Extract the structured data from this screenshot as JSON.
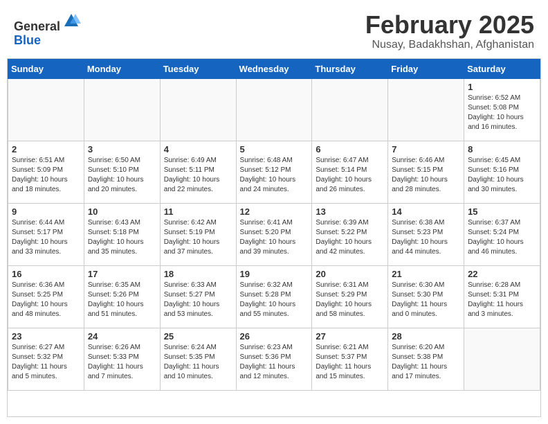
{
  "logo": {
    "general": "General",
    "blue": "Blue"
  },
  "header": {
    "month": "February 2025",
    "location": "Nusay, Badakhshan, Afghanistan"
  },
  "weekdays": [
    "Sunday",
    "Monday",
    "Tuesday",
    "Wednesday",
    "Thursday",
    "Friday",
    "Saturday"
  ],
  "weeks": [
    [
      {
        "day": "",
        "info": ""
      },
      {
        "day": "",
        "info": ""
      },
      {
        "day": "",
        "info": ""
      },
      {
        "day": "",
        "info": ""
      },
      {
        "day": "",
        "info": ""
      },
      {
        "day": "",
        "info": ""
      },
      {
        "day": "1",
        "info": "Sunrise: 6:52 AM\nSunset: 5:08 PM\nDaylight: 10 hours\nand 16 minutes."
      }
    ],
    [
      {
        "day": "2",
        "info": "Sunrise: 6:51 AM\nSunset: 5:09 PM\nDaylight: 10 hours\nand 18 minutes."
      },
      {
        "day": "3",
        "info": "Sunrise: 6:50 AM\nSunset: 5:10 PM\nDaylight: 10 hours\nand 20 minutes."
      },
      {
        "day": "4",
        "info": "Sunrise: 6:49 AM\nSunset: 5:11 PM\nDaylight: 10 hours\nand 22 minutes."
      },
      {
        "day": "5",
        "info": "Sunrise: 6:48 AM\nSunset: 5:12 PM\nDaylight: 10 hours\nand 24 minutes."
      },
      {
        "day": "6",
        "info": "Sunrise: 6:47 AM\nSunset: 5:14 PM\nDaylight: 10 hours\nand 26 minutes."
      },
      {
        "day": "7",
        "info": "Sunrise: 6:46 AM\nSunset: 5:15 PM\nDaylight: 10 hours\nand 28 minutes."
      },
      {
        "day": "8",
        "info": "Sunrise: 6:45 AM\nSunset: 5:16 PM\nDaylight: 10 hours\nand 30 minutes."
      }
    ],
    [
      {
        "day": "9",
        "info": "Sunrise: 6:44 AM\nSunset: 5:17 PM\nDaylight: 10 hours\nand 33 minutes."
      },
      {
        "day": "10",
        "info": "Sunrise: 6:43 AM\nSunset: 5:18 PM\nDaylight: 10 hours\nand 35 minutes."
      },
      {
        "day": "11",
        "info": "Sunrise: 6:42 AM\nSunset: 5:19 PM\nDaylight: 10 hours\nand 37 minutes."
      },
      {
        "day": "12",
        "info": "Sunrise: 6:41 AM\nSunset: 5:20 PM\nDaylight: 10 hours\nand 39 minutes."
      },
      {
        "day": "13",
        "info": "Sunrise: 6:39 AM\nSunset: 5:22 PM\nDaylight: 10 hours\nand 42 minutes."
      },
      {
        "day": "14",
        "info": "Sunrise: 6:38 AM\nSunset: 5:23 PM\nDaylight: 10 hours\nand 44 minutes."
      },
      {
        "day": "15",
        "info": "Sunrise: 6:37 AM\nSunset: 5:24 PM\nDaylight: 10 hours\nand 46 minutes."
      }
    ],
    [
      {
        "day": "16",
        "info": "Sunrise: 6:36 AM\nSunset: 5:25 PM\nDaylight: 10 hours\nand 48 minutes."
      },
      {
        "day": "17",
        "info": "Sunrise: 6:35 AM\nSunset: 5:26 PM\nDaylight: 10 hours\nand 51 minutes."
      },
      {
        "day": "18",
        "info": "Sunrise: 6:33 AM\nSunset: 5:27 PM\nDaylight: 10 hours\nand 53 minutes."
      },
      {
        "day": "19",
        "info": "Sunrise: 6:32 AM\nSunset: 5:28 PM\nDaylight: 10 hours\nand 55 minutes."
      },
      {
        "day": "20",
        "info": "Sunrise: 6:31 AM\nSunset: 5:29 PM\nDaylight: 10 hours\nand 58 minutes."
      },
      {
        "day": "21",
        "info": "Sunrise: 6:30 AM\nSunset: 5:30 PM\nDaylight: 11 hours\nand 0 minutes."
      },
      {
        "day": "22",
        "info": "Sunrise: 6:28 AM\nSunset: 5:31 PM\nDaylight: 11 hours\nand 3 minutes."
      }
    ],
    [
      {
        "day": "23",
        "info": "Sunrise: 6:27 AM\nSunset: 5:32 PM\nDaylight: 11 hours\nand 5 minutes."
      },
      {
        "day": "24",
        "info": "Sunrise: 6:26 AM\nSunset: 5:33 PM\nDaylight: 11 hours\nand 7 minutes."
      },
      {
        "day": "25",
        "info": "Sunrise: 6:24 AM\nSunset: 5:35 PM\nDaylight: 11 hours\nand 10 minutes."
      },
      {
        "day": "26",
        "info": "Sunrise: 6:23 AM\nSunset: 5:36 PM\nDaylight: 11 hours\nand 12 minutes."
      },
      {
        "day": "27",
        "info": "Sunrise: 6:21 AM\nSunset: 5:37 PM\nDaylight: 11 hours\nand 15 minutes."
      },
      {
        "day": "28",
        "info": "Sunrise: 6:20 AM\nSunset: 5:38 PM\nDaylight: 11 hours\nand 17 minutes."
      },
      {
        "day": "",
        "info": ""
      }
    ]
  ]
}
